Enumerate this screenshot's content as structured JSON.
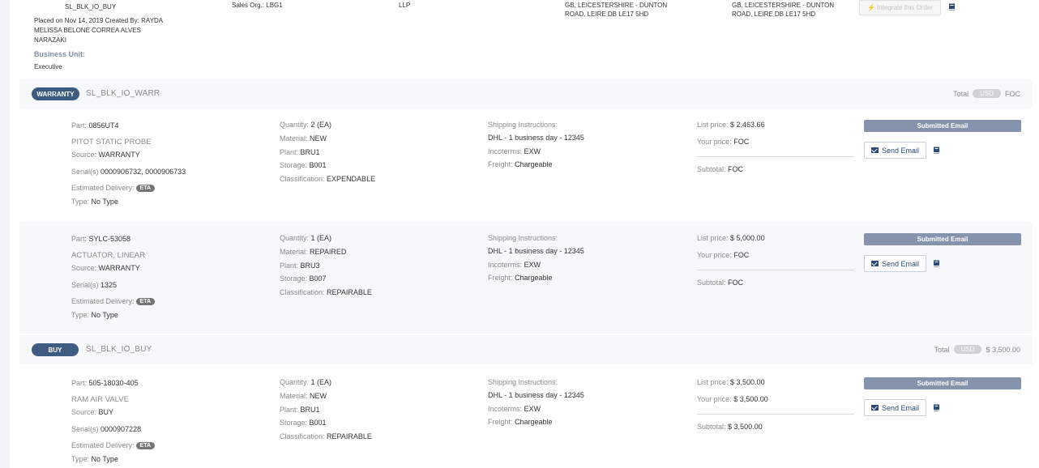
{
  "order_header": {
    "order_code": "SL_BLK_IO_BUY",
    "placed_line1": "Placed on Nov 14, 2019 Created By: RAYDA",
    "placed_line2": "MELISSA BELONE CORREA ALVES",
    "placed_line3": "NARAZAKI",
    "business_unit_label": "Business Unit:",
    "business_unit_value": "Executive",
    "sales_org": "Sales Org.: LBG1",
    "company_suffix": "LLP",
    "address1_line1": "GB, LEICESTERSHIRE - DUNTON",
    "address1_line2": "ROAD, LEIRE DB LE17 5HD",
    "address2_line1": "GB, LEICESTERSHIRE - DUNTON",
    "address2_line2": "ROAD, LEIRE DB LE17 5HD",
    "integrate_button": "Integrate this Order",
    "integrate_icon": "bolt-icon",
    "book_icon": "book-icon"
  },
  "groups": [
    {
      "badge": "WARRANTY",
      "code": "SL_BLK_IO_WARR",
      "total_label": "Total",
      "currency": "USD",
      "total_value": "FOC",
      "items": [
        {
          "part_label": "Part:",
          "part": "0856UT4",
          "name": "PITOT STATIC PROBE",
          "source_label": "Source:",
          "source": "WARRANTY",
          "serial_label": "Serial(s)",
          "serial": "0000906732, 0000906733",
          "delivery_label": "Estimated Delivery:",
          "eta": "ETA",
          "type_label": "Type:",
          "type": "No Type",
          "quantity_label": "Quantity:",
          "quantity": "2 (EA)",
          "material_label": "Material:",
          "material": "NEW",
          "plant_label": "Plant:",
          "plant": "BRU1",
          "storage_label": "Storage:",
          "storage": "B001",
          "classification_label": "Classification:",
          "classification": "EXPENDABLE",
          "shipping_label": "Shipping Instructions:",
          "shipping": "DHL - 1 business day - 12345",
          "incoterms_label": "Incoterms:",
          "incoterms": "EXW",
          "freight_label": "Freight:",
          "freight": "Chargeable",
          "list_price_label": "List price:",
          "list_price": "$ 2,463.66",
          "your_price_label": "Your price:",
          "your_price": "FOC",
          "subtotal_label": "Subtotal:",
          "subtotal": "FOC",
          "status": "Submitted Email",
          "send_email": "Send Email"
        },
        {
          "part_label": "Part:",
          "part": "SYLC-53058",
          "name": "ACTUATOR, LINEAR",
          "source_label": "Source:",
          "source": "WARRANTY",
          "serial_label": "Serial(s)",
          "serial": "1325",
          "delivery_label": "Estimated Delivery:",
          "eta": "ETA",
          "type_label": "Type:",
          "type": "No Type",
          "quantity_label": "Quantity:",
          "quantity": "1 (EA)",
          "material_label": "Material:",
          "material": "REPAIRED",
          "plant_label": "Plant:",
          "plant": "BRU3",
          "storage_label": "Storage:",
          "storage": "B007",
          "classification_label": "Classification:",
          "classification": "REPAIRABLE",
          "shipping_label": "Shipping Instructions:",
          "shipping": "DHL - 1 business day - 12345",
          "incoterms_label": "Incoterms:",
          "incoterms": "EXW",
          "freight_label": "Freight:",
          "freight": "Chargeable",
          "list_price_label": "List price:",
          "list_price": "$ 5,000.00",
          "your_price_label": "Your price:",
          "your_price": "FOC",
          "subtotal_label": "Subtotal:",
          "subtotal": "FOC",
          "status": "Submitted Email",
          "send_email": "Send Email"
        }
      ]
    },
    {
      "badge": "BUY",
      "code": "SL_BLK_IO_BUY",
      "total_label": "Total",
      "currency": "USD",
      "total_value": "$ 3,500.00",
      "items": [
        {
          "part_label": "Part:",
          "part": "505-18030-405",
          "name": "RAM AIR VALVE",
          "source_label": "Source:",
          "source": "BUY",
          "serial_label": "Serial(s)",
          "serial": "0000907228",
          "delivery_label": "Estimated Delivery:",
          "eta": "ETA",
          "type_label": "Type:",
          "type": "No Type",
          "quantity_label": "Quantity:",
          "quantity": "1 (EA)",
          "material_label": "Material:",
          "material": "NEW",
          "plant_label": "Plant:",
          "plant": "BRU1",
          "storage_label": "Storage:",
          "storage": "B001",
          "classification_label": "Classification:",
          "classification": "REPAIRABLE",
          "shipping_label": "Shipping Instructions:",
          "shipping": "DHL - 1 business day - 12345",
          "incoterms_label": "Incoterms:",
          "incoterms": "EXW",
          "freight_label": "Freight:",
          "freight": "Chargeable",
          "list_price_label": "List price:",
          "list_price": "$ 3,500.00",
          "your_price_label": "Your price:",
          "your_price": "$ 3,500.00",
          "subtotal_label": "Subtotal:",
          "subtotal": "$ 3,500.00",
          "status": "Submitted Email",
          "send_email": "Send Email"
        }
      ]
    }
  ]
}
